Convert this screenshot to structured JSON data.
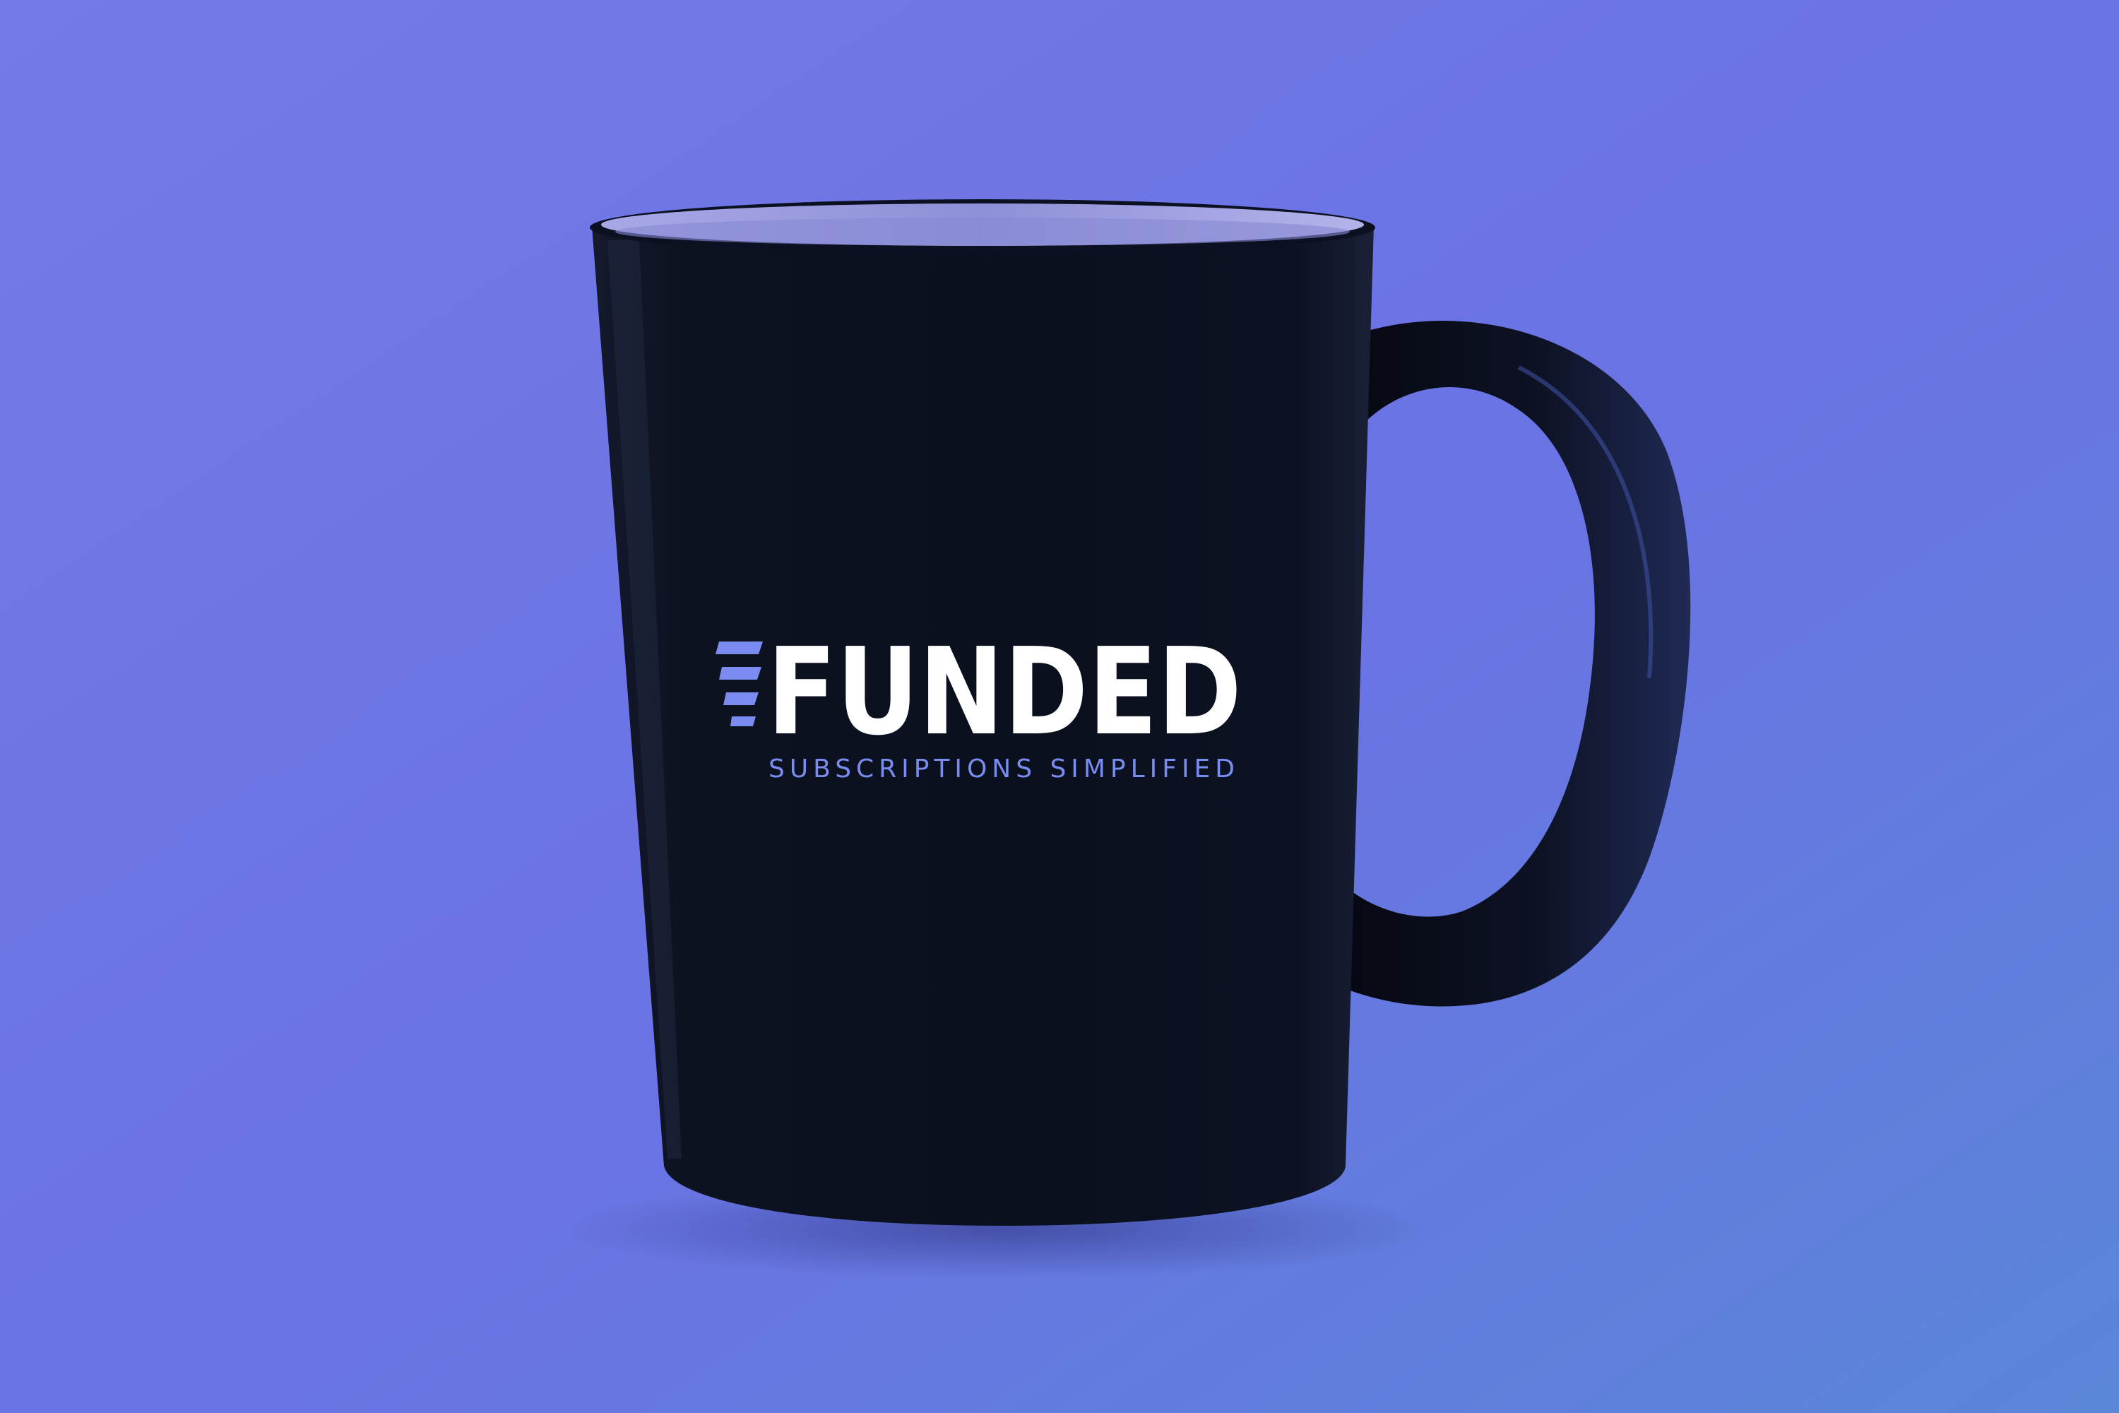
{
  "scene": {
    "subject": "mug-product-photo",
    "colors": {
      "background_top": "#6f78e8",
      "background_bottom": "#5a82d8",
      "mug_body": "#0b1120",
      "mug_rim_inner": "#8d8fd6",
      "brand_white": "#ffffff",
      "brand_accent": "#7a8cf0"
    }
  },
  "logo": {
    "word": "FUNDED",
    "tagline": "SUBSCRIPTIONS SIMPLIFIED",
    "mark_icon": "speed-lines-icon"
  }
}
